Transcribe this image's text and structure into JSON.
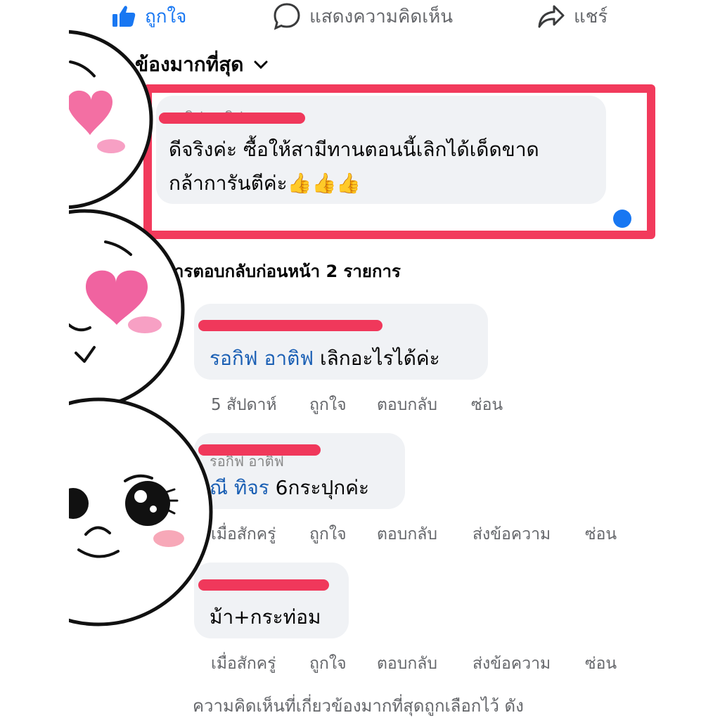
{
  "actions": {
    "like_label": "ถูกใจ",
    "comment_label": "แสดงความคิดเห็น",
    "share_label": "แชร์"
  },
  "sort": {
    "label": "ข้องมากที่สุด"
  },
  "comments": [
    {
      "name": "รอกิฟ อาติฟ",
      "text_line1": "ดีจริงค่ะ ซื้อให้สามีทานตอนนี้เลิกได้เด็ดขาด",
      "text_line2": "กล้าการันตีค่ะ👍👍👍"
    }
  ],
  "previous_replies_label": "ารตอบกลับก่อนหน้า 2 รายการ",
  "replies": [
    {
      "name": "",
      "mention": "รอกิฟ อาติฟ",
      "text": " เลิกอะไรได้ค่ะ",
      "time": "5 สัปดาห์",
      "like": "ถูกใจ",
      "reply": "ตอบกลับ",
      "hide": "ซ่อน"
    },
    {
      "name": "รอกิฟ อาติฟ",
      "mention": "ณี ทิจร",
      "text": " 6กระปุกค่ะ",
      "time": "เมื่อสักครู่",
      "like": "ถูกใจ",
      "reply": "ตอบกลับ",
      "message": "ส่งข้อความ",
      "hide": "ซ่อน"
    },
    {
      "name": "",
      "text": "ม้า+กระท่อม",
      "time": "เมื่อสักครู่",
      "like": "ถูกใจ",
      "reply": "ตอบกลับ",
      "message": "ส่งข้อความ",
      "hide": "ซ่อน"
    }
  ],
  "footer_text": "ความคิดเห็นที่เกี่ยวข้องมากที่สุดถูกเลือกไว้ ดัง",
  "colors": {
    "accent": "#1877f2",
    "highlight_frame": "#f23a5c",
    "redaction": "#f0385b",
    "bubble": "#f0f2f5",
    "mention": "#1a5fb4"
  },
  "icons": {
    "like": "thumbs-up-icon",
    "comment": "speech-bubble-icon",
    "share": "share-arrow-icon",
    "sort": "chevron-down-icon"
  }
}
